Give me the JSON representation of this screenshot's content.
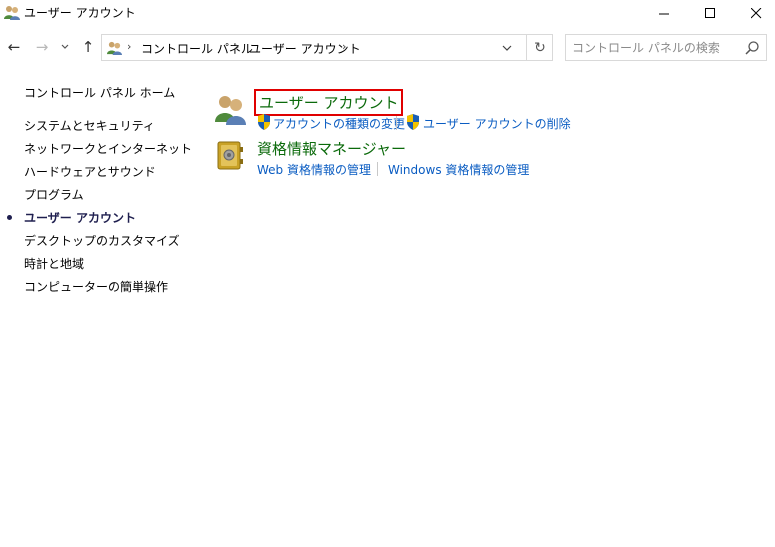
{
  "window": {
    "title": "ユーザー アカウント",
    "minimize_glyph": "─",
    "maximize_glyph": "☐",
    "close_glyph": "✕"
  },
  "nav": {
    "back_glyph": "←",
    "forward_glyph": "→",
    "history_glyph": "⌄",
    "up_glyph": "↑"
  },
  "address": {
    "crumbs": [
      "コントロール パネル",
      "ユーザー アカウント"
    ],
    "separator": "›",
    "dropdown_glyph": "⌄",
    "refresh_glyph": "↻"
  },
  "search": {
    "placeholder": "コントロール パネルの検索"
  },
  "leftnav": {
    "home": "コントロール パネル ホーム",
    "items": [
      {
        "label": "システムとセキュリティ",
        "current": false
      },
      {
        "label": "ネットワークとインターネット",
        "current": false
      },
      {
        "label": "ハードウェアとサウンド",
        "current": false
      },
      {
        "label": "プログラム",
        "current": false
      },
      {
        "label": "ユーザー アカウント",
        "current": true
      },
      {
        "label": "デスクトップのカスタマイズ",
        "current": false
      },
      {
        "label": "時計と地域",
        "current": false
      },
      {
        "label": "コンピューターの簡単操作",
        "current": false
      }
    ]
  },
  "main": {
    "user_accounts": {
      "title": "ユーザー アカウント",
      "links": [
        "アカウントの種類の変更",
        "ユーザー アカウントの削除"
      ]
    },
    "credential_manager": {
      "title": "資格情報マネージャー",
      "links": [
        "Web 資格情報の管理",
        "Windows 資格情報の管理"
      ]
    }
  },
  "colors": {
    "category_title": "#0b6a0b",
    "link": "#0a5cc2",
    "highlight_border": "#e00000",
    "current_nav": "#1f1f4f"
  }
}
